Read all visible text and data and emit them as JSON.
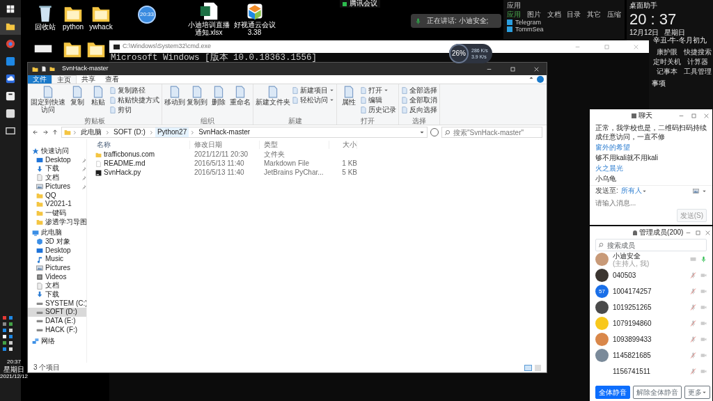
{
  "taskbar": {
    "apps": [
      {
        "kind": "windows",
        "selected": false
      },
      {
        "kind": "folder",
        "selected": true
      },
      {
        "kind": "browser",
        "selected": false
      },
      {
        "kind": "pin",
        "selected": false
      },
      {
        "kind": "cloud",
        "selected": false
      },
      {
        "kind": "seven",
        "selected": false
      },
      {
        "kind": "box",
        "selected": false
      },
      {
        "kind": "screen",
        "selected": false
      }
    ],
    "clock": {
      "time": "20:37",
      "weekday": "星期日",
      "date": "2021/12/12"
    }
  },
  "desktop_icons": [
    {
      "kind": "bin",
      "label": "回收站"
    },
    {
      "kind": "folder",
      "label": "python"
    },
    {
      "kind": "folder",
      "label": "ywhack"
    },
    {
      "kind": "clock",
      "label": "20:33"
    },
    {
      "kind": "excel",
      "label": "小迪培训直播通知.xlsx"
    },
    {
      "kind": "app",
      "label": "好视通云会议 3.38"
    },
    {
      "kind": "file"
    },
    {
      "kind": "folder"
    },
    {
      "kind": "folder"
    }
  ],
  "meeting_bar": {
    "label": "腾讯会议"
  },
  "speaking": {
    "text": "正在讲话: 小迪安全;"
  },
  "app_panel": {
    "title": "应用",
    "tabs": [
      {
        "label": "应用",
        "selected": true
      },
      {
        "label": "图片",
        "selected": false
      },
      {
        "label": "文档",
        "selected": false
      },
      {
        "label": "目录",
        "selected": false
      },
      {
        "label": "其它",
        "selected": false
      },
      {
        "label": "压缩",
        "selected": false
      }
    ],
    "apps": [
      "Telegram",
      "TommSea"
    ]
  },
  "assistant": {
    "title": "桌面助手",
    "time": "20 : 37",
    "date": "12月12日",
    "weekday": "星期日",
    "lunar": "辛丑-牛-冬月初九",
    "tools": [
      "康护眼",
      "快捷搜索",
      "定时关机",
      "计算器",
      "记事本",
      "工具管理"
    ],
    "section": "事项"
  },
  "cmd": {
    "title": "C:\\Windows\\System32\\cmd.exe",
    "line": "Microsoft Windows [版本 10.0.18363.1556]"
  },
  "net_widget": {
    "percent": "26%",
    "down": "286 K/s",
    "up": "3.9 K/s"
  },
  "explorer": {
    "title": "SvnHack-master",
    "tabs": [
      {
        "label": "文件",
        "kind": "file",
        "selected": false
      },
      {
        "label": "主页",
        "kind": "tab",
        "selected": true
      },
      {
        "label": "共享",
        "kind": "tab",
        "selected": false
      },
      {
        "label": "查看",
        "kind": "tab",
        "selected": false
      }
    ],
    "ribbon": [
      {
        "label": "剪贴板",
        "items": [
          {
            "label": "固定到快速访问",
            "kind": "large"
          },
          {
            "label": "复制",
            "kind": "large"
          },
          {
            "label": "粘贴",
            "kind": "large"
          },
          {
            "label": "复制路径",
            "kind": "small"
          },
          {
            "label": "粘贴快捷方式",
            "kind": "small"
          },
          {
            "label": "剪切",
            "kind": "small"
          }
        ]
      },
      {
        "label": "组织",
        "items": [
          {
            "label": "移动到",
            "kind": "large"
          },
          {
            "label": "复制到",
            "kind": "large"
          },
          {
            "label": "删除",
            "kind": "large"
          },
          {
            "label": "重命名",
            "kind": "large"
          }
        ]
      },
      {
        "label": "新建",
        "items": [
          {
            "label": "新建文件夹",
            "kind": "large"
          },
          {
            "label": "新建项目",
            "kind": "small",
            "dropdown": true
          },
          {
            "label": "轻松访问",
            "kind": "small",
            "dropdown": true
          }
        ]
      },
      {
        "label": "打开",
        "items": [
          {
            "label": "属性",
            "kind": "large"
          },
          {
            "label": "打开",
            "kind": "small",
            "dropdown": true
          },
          {
            "label": "编辑",
            "kind": "small"
          },
          {
            "label": "历史记录",
            "kind": "small"
          }
        ]
      },
      {
        "label": "选择",
        "items": [
          {
            "label": "全部选择",
            "kind": "small"
          },
          {
            "label": "全部取消",
            "kind": "small"
          },
          {
            "label": "反向选择",
            "kind": "small"
          }
        ]
      }
    ],
    "path": [
      {
        "label": "此电脑",
        "highlighted": false
      },
      {
        "label": "SOFT (D:)",
        "highlighted": false
      },
      {
        "label": "Python27",
        "highlighted": true
      },
      {
        "label": "SvnHack-master",
        "highlighted": false
      }
    ],
    "search": {
      "placeholder": "搜索\"SvnHack-master\""
    },
    "nav": [
      {
        "label": "快速访问",
        "kind": "star",
        "selected": false,
        "children": [
          {
            "label": "Desktop",
            "kind": "desktop",
            "pinned": true,
            "selected": false
          },
          {
            "label": "下载",
            "kind": "download",
            "pinned": true,
            "selected": false
          },
          {
            "label": "文档",
            "kind": "document",
            "pinned": true,
            "selected": false
          },
          {
            "label": "Pictures",
            "kind": "picture",
            "pinned": true,
            "selected": false
          },
          {
            "label": "QQ",
            "kind": "folder",
            "pinned": false,
            "selected": false
          },
          {
            "label": "V2021-1",
            "kind": "folder",
            "pinned": false,
            "selected": false
          },
          {
            "label": "一键码",
            "kind": "folder",
            "pinned": false,
            "selected": false
          },
          {
            "label": "渗透学习导图",
            "kind": "folder",
            "pinned": false,
            "selected": false
          }
        ]
      },
      {
        "label": "此电脑",
        "kind": "pc",
        "selected": false,
        "children": [
          {
            "label": "3D 对象",
            "kind": "cube",
            "selected": false
          },
          {
            "label": "Desktop",
            "kind": "desktop",
            "selected": false
          },
          {
            "label": "Music",
            "kind": "music",
            "selected": false
          },
          {
            "label": "Pictures",
            "kind": "picture",
            "selected": false
          },
          {
            "label": "Videos",
            "kind": "video",
            "selected": false
          },
          {
            "label": "文档",
            "kind": "document",
            "selected": false
          },
          {
            "label": "下载",
            "kind": "download",
            "selected": false
          },
          {
            "label": "SYSTEM (C:)",
            "kind": "drive",
            "selected": false
          },
          {
            "label": "SOFT (D:)",
            "kind": "drive",
            "selected": true
          },
          {
            "label": "DATA (E:)",
            "kind": "drive",
            "selected": false
          },
          {
            "label": "HACK (F:)",
            "kind": "drive",
            "selected": false
          }
        ]
      },
      {
        "label": "网络",
        "kind": "network",
        "selected": false
      }
    ],
    "columns": [
      "名称",
      "修改日期",
      "类型",
      "大小"
    ],
    "files": [
      {
        "kind": "folder",
        "name": "trafficbonus.com",
        "date": "2021/12/11 20:30",
        "type": "文件夹"
      },
      {
        "kind": "markdown",
        "name": "README.md",
        "date": "2016/5/13 11:40",
        "type": "Markdown File",
        "size": "1 KB"
      },
      {
        "kind": "python",
        "name": "SvnHack.py",
        "date": "2016/5/13 11:40",
        "type": "JetBrains PyChar...",
        "size": "5 KB"
      }
    ],
    "status": "3 个项目"
  },
  "chat": {
    "title": "聊天",
    "messages": [
      {
        "kind": "text",
        "text": "正常，我学校也是，二维码扫码持续成任意访问，一直不修"
      },
      {
        "kind": "sender",
        "text": "窗外的希望"
      },
      {
        "kind": "text",
        "text": "够不用kali就不用kali"
      },
      {
        "kind": "sender",
        "text": "火之晨光"
      },
      {
        "kind": "text",
        "text": "小乌龟"
      }
    ],
    "send_to_label": "发送至:",
    "send_to": "所有人",
    "placeholder": "请输入消息...",
    "send_button": "发送(S)"
  },
  "members": {
    "title": "管理成员(200)",
    "search": {
      "placeholder": "搜索成员"
    },
    "list": [
      {
        "name": "小迪安全",
        "note": "(主持人, 我)",
        "avatar": {
          "kind": "photo",
          "color": "#c89a78"
        },
        "muted": false,
        "host": true
      },
      {
        "name": "040503",
        "avatar": {
          "kind": "photo",
          "color": "#3b3530"
        },
        "muted": true,
        "host": false
      },
      {
        "name": "1004174257",
        "avatar": {
          "kind": "text",
          "text": "57",
          "color": "#1a6fe8"
        },
        "muted": true,
        "host": false
      },
      {
        "name": "1019251265",
        "avatar": {
          "kind": "photo",
          "color": "#4a4a4a"
        },
        "muted": true,
        "host": false
      },
      {
        "name": "1079194860",
        "avatar": {
          "kind": "color",
          "color": "#f8c81c"
        },
        "muted": true,
        "host": false
      },
      {
        "name": "1093899433",
        "avatar": {
          "kind": "photo",
          "color": "#d9874a"
        },
        "muted": true,
        "host": false
      },
      {
        "name": "1145821685",
        "avatar": {
          "kind": "photo",
          "color": "#7a8a9a"
        },
        "muted": true,
        "host": false
      },
      {
        "name": "1156741511",
        "muted": true,
        "host": false
      }
    ],
    "buttons": [
      {
        "label": "全体静音",
        "kind": "primary"
      },
      {
        "label": "解除全体静音",
        "kind": "outline"
      },
      {
        "label": "更多",
        "kind": "dropdown"
      }
    ]
  }
}
